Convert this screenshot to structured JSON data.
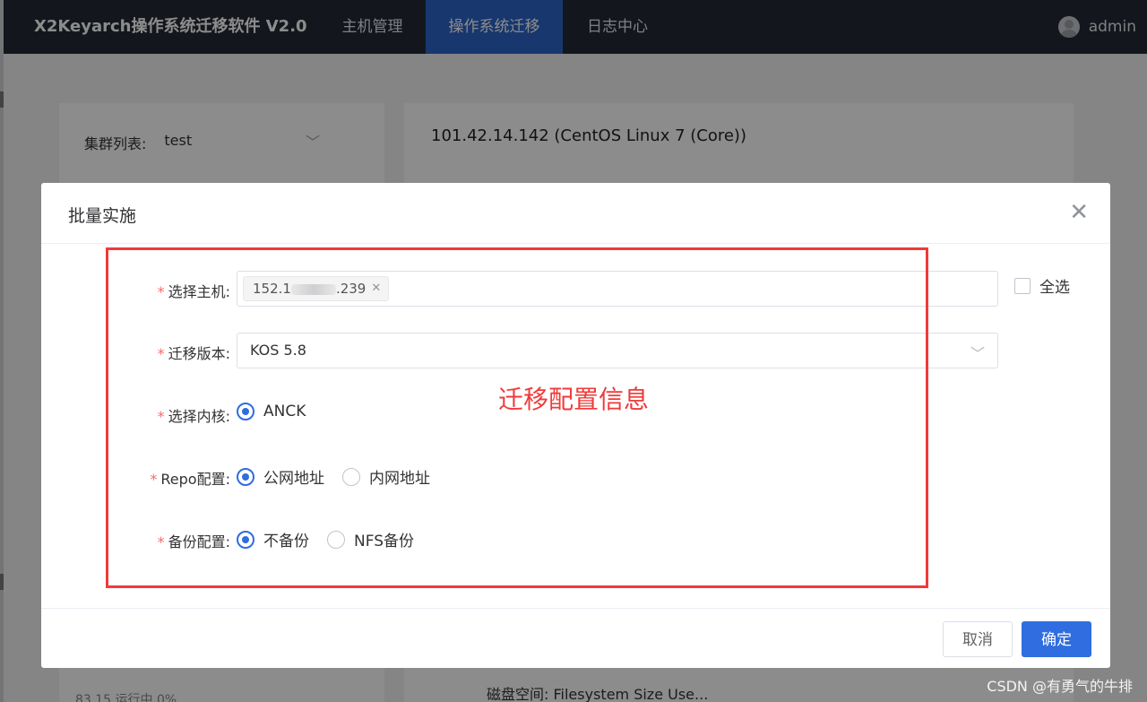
{
  "topbar": {
    "brand": "X2Keyarch操作系统迁移软件 V2.0",
    "nav": [
      {
        "label": "主机管理",
        "active": false
      },
      {
        "label": "操作系统迁移",
        "active": true
      },
      {
        "label": "日志中心",
        "active": false
      }
    ],
    "user": "admin"
  },
  "background": {
    "cluster_label": "集群列表:",
    "cluster_value": "test",
    "host_title": "101.42.14.142 (CentOS Linux 7 (Core))",
    "disk_label": "磁盘空间:",
    "disk_value": "Filesystem Size Use...",
    "partial_row": "83.15 运行中 0%"
  },
  "dialog": {
    "title": "批量实施",
    "select_all": "全选",
    "fields": {
      "host": {
        "label": "选择主机:",
        "tag_prefix": "152.1",
        "tag_suffix": ".239"
      },
      "version": {
        "label": "迁移版本:",
        "value": "KOS 5.8"
      },
      "kernel": {
        "label": "选择内核:",
        "options": [
          "ANCK"
        ]
      },
      "repo": {
        "label": "Repo配置:",
        "options": [
          "公网地址",
          "内网地址"
        ]
      },
      "backup": {
        "label": "备份配置:",
        "options": [
          "不备份",
          "NFS备份"
        ]
      }
    },
    "cancel": "取消",
    "ok": "确定"
  },
  "annotation": "迁移配置信息",
  "watermark": "CSDN @有勇气的牛排",
  "colors": {
    "accent": "#2f6de0",
    "topbar": "#242a35",
    "annotation": "#f03a3a"
  }
}
